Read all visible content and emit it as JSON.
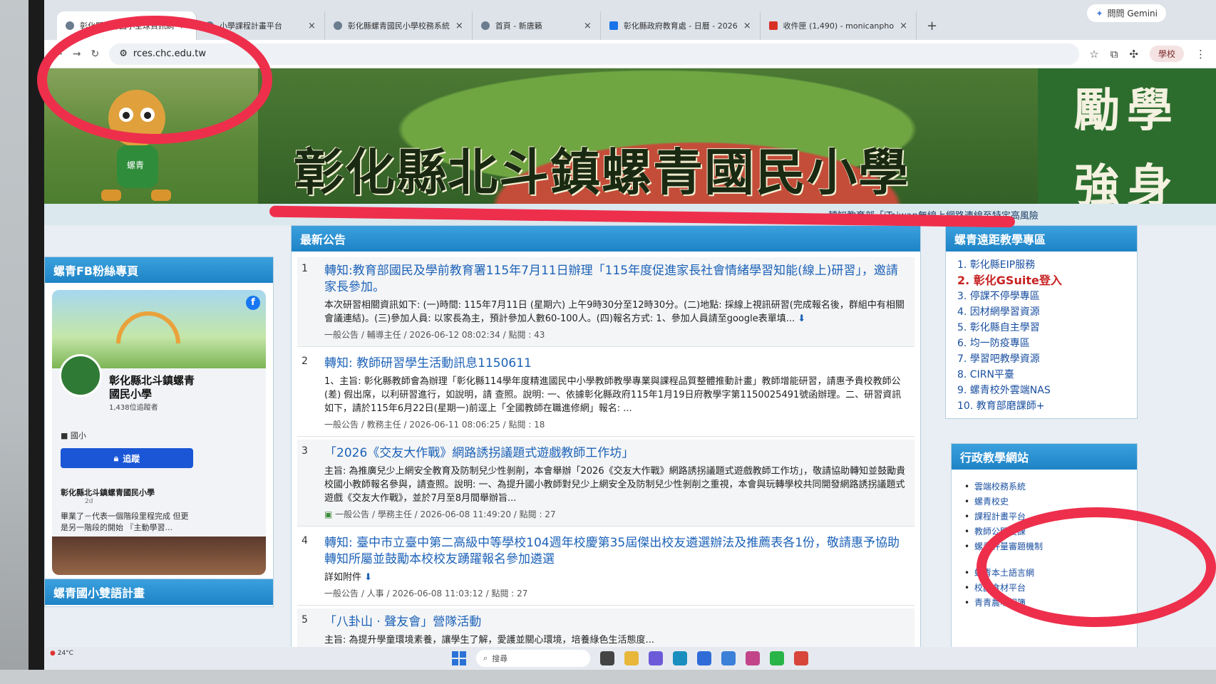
{
  "browser": {
    "tabs": [
      {
        "label": "彰化縣螺青國小全球資訊網",
        "active": true
      },
      {
        "label": "小學課程計畫平台",
        "active": false
      },
      {
        "label": "彰化縣螺青國民小學校務系統",
        "active": false
      },
      {
        "label": "首頁 - 新唐籟",
        "active": false
      },
      {
        "label": "彰化縣政府教育處 - 日曆 - 2026",
        "active": false
      },
      {
        "label": "收件匣 (1,490) - monicanpho",
        "active": false
      }
    ],
    "gemini_label": "問問 Gemini",
    "url": "rces.chc.edu.tw",
    "profile_label": "學校"
  },
  "banner": {
    "school_name": "彰化縣北斗鎮螺青國民小學",
    "motto_line1": "勵學",
    "motto_line2": "強身",
    "mascot_tag": "螺青",
    "marquee": "轉知教育部「iTaiwan無線上網路連線至特定高風險"
  },
  "fb_panel": {
    "heading": "螺青FB粉絲專頁",
    "page_name": "彰化縣北斗鎮螺青國民小學",
    "followers": "1,438位追蹤者",
    "category": "國小",
    "follow_label": "追蹤",
    "post_author": "彰化縣北斗鎮螺青國民小學",
    "post_time": "2d",
    "post_text": "畢業了－代表一個階段里程完成 但更是另一階段的開始 『主動學習..."
  },
  "bilingual": {
    "heading": "螺青國小雙語計畫"
  },
  "announcements": {
    "heading": "最新公告",
    "items": [
      {
        "num": "1",
        "title": "轉知:教育部國民及學前教育署115年7月11日辦理「115年度促進家長社會情緒學習知能(線上)研習」，邀請家長參加。",
        "summary": "本次研習相關資訊如下: (一)時間: 115年7月11日 (星期六) 上午9時30分至12時30分。(二)地點: 採線上視訊研習(完成報名後，群組中有相關會議連結)。(三)參加人員: 以家長為主，預計參加人數60-100人。(四)報名方式: 1、參加人員請至google表單填...",
        "meta": "一般公告 / 輔導主任 / 2026-06-12 08:02:34 / 點閱 : 43"
      },
      {
        "num": "2",
        "title": "轉知: 教師研習學生活動訊息1150611",
        "summary": "1、主旨: 彰化縣教師會為辦理「彰化縣114學年度精進國民中小學教師教學專業與課程品質整體推動計畫」教師增能研習，請惠予貴校教師公 (差) 假出席，以利研習進行，如說明，請 查照。說明: 一、依據彰化縣政府115年1月19日府教學字第1150025491號函辦理。二、研習資訊如下，請於115年6月22日(星期一)前逕上「全國教師在職進修網」報名: ...",
        "meta": "一般公告 / 教務主任 / 2026-06-11 08:06:25 / 點閱 : 18"
      },
      {
        "num": "3",
        "title": "「2026《交友大作戰》網路誘拐議題式遊戲教師工作坊」",
        "summary": "主旨: 為推廣兒少上網安全教育及防制兒少性剝削，本會舉辦「2026《交友大作戰》網路誘拐議題式遊戲教師工作坊」，敬請協助轉知並鼓勵貴校國小教師報名參與，請查照。說明: 一、為提升國小教師對兒少上網安全及防制兒少性剝削之重視，本會與玩轉學校共同開發網路誘拐議題式遊戲《交友大作戰》，並於7月至8月間舉辦旨...",
        "meta": "一般公告 / 學務主任 / 2026-06-08 11:49:20 / 點閱 : 27"
      },
      {
        "num": "4",
        "title": "轉知: 臺中市立臺中第二高級中等學校104週年校慶第35屆傑出校友遴選辦法及推薦表各1份，敬請惠予協助轉知所屬並鼓勵本校校友踴躍報名參加遴選",
        "summary": "詳如附件",
        "meta": "一般公告 / 人事 / 2026-06-08 11:03:12 / 點閱 : 27"
      },
      {
        "num": "5",
        "title": "「八卦山 · 聲友會」營隊活動",
        "summary": "主旨: 為提升學童環境素養，讓學生了解，愛護並關心環境，培養綠色生活態度...",
        "meta": ""
      }
    ]
  },
  "remote": {
    "heading": "螺青遠距教學專區",
    "items": [
      {
        "label": "1. 彰化縣EIP服務",
        "hl": false
      },
      {
        "label": "2. 彰化GSuite登入",
        "hl": true
      },
      {
        "label": "3. 停課不停學專區",
        "hl": false
      },
      {
        "label": "4. 因材網學習資源",
        "hl": false
      },
      {
        "label": "5. 彰化縣自主學習",
        "hl": false
      },
      {
        "label": "6. 均一防疫專區",
        "hl": false
      },
      {
        "label": "7. 學習吧教學資源",
        "hl": false
      },
      {
        "label": "8. CIRN平臺",
        "hl": false
      },
      {
        "label": "9. 螺青校外雲端NAS",
        "hl": false
      },
      {
        "label": "10. 教育部磨課師+",
        "hl": false
      }
    ]
  },
  "admin": {
    "heading": "行政教學網站",
    "items": [
      "雲端校務系統",
      "螺青校史",
      "課程計畫平台",
      "教師公開授課",
      "螺青評量審題機制",
      "螺青本土語言網",
      "校園食材平台",
      "青青農場相簿"
    ]
  },
  "taskbar": {
    "weather": "24°C",
    "search_placeholder": "搜尋"
  },
  "colors": {
    "accent_blue": "#1e83c6",
    "link_blue": "#1c62b8",
    "highlight_red": "#ee2f4c",
    "banner_green": "#2c6d2e"
  }
}
